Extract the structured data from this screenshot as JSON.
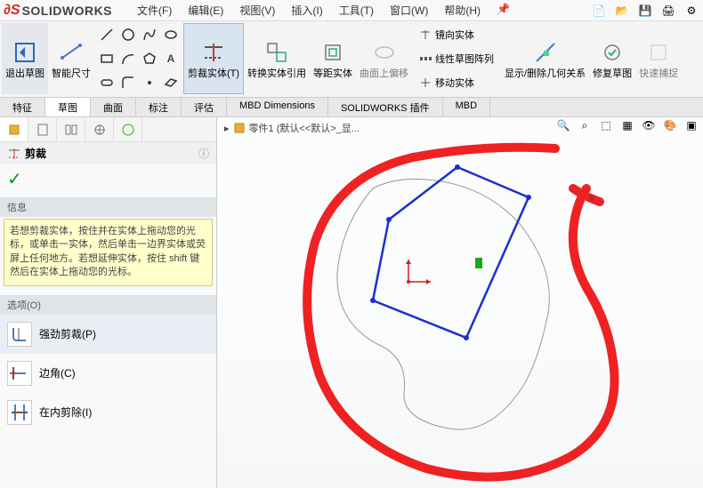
{
  "app": {
    "name": "SOLIDWORKS"
  },
  "menubar": {
    "items": [
      "文件(F)",
      "编辑(E)",
      "视图(V)",
      "插入(I)",
      "工具(T)",
      "窗口(W)",
      "帮助(H)"
    ]
  },
  "ribbon": {
    "exit_sketch": "退出草图",
    "smart_dim": "智能尺寸",
    "trim": "剪裁实体(T)",
    "convert": "转换实体引用",
    "offset": "等距实体",
    "offset_surf": "曲面上偏移",
    "mirror": "镜向实体",
    "linear_pattern": "线性草图阵列",
    "move": "移动实体",
    "show_hide": "显示/删除几何关系",
    "repair": "修复草图",
    "quick_snap": "快速捕捉"
  },
  "tabs": [
    "特征",
    "草图",
    "曲面",
    "标注",
    "评估",
    "MBD Dimensions",
    "SOLIDWORKS 插件",
    "MBD"
  ],
  "active_tab": "草图",
  "canvas": {
    "part_name": "零件1 (默认<<默认>_显..."
  },
  "pm": {
    "title": "剪裁",
    "info_head": "信息",
    "info_body": "若想剪裁实体，按住并在实体上拖动您的光标，或单击一实体，然后单击一边界实体或荧屏上任何地方。若想延伸实体，按住 shift 键然后在实体上拖动您的光标。",
    "options_head": "选项(O)",
    "options": [
      {
        "label": "强劲剪裁(P)",
        "selected": true
      },
      {
        "label": "边角(C)",
        "selected": false
      },
      {
        "label": "在内剪除(I)",
        "selected": false
      }
    ]
  }
}
